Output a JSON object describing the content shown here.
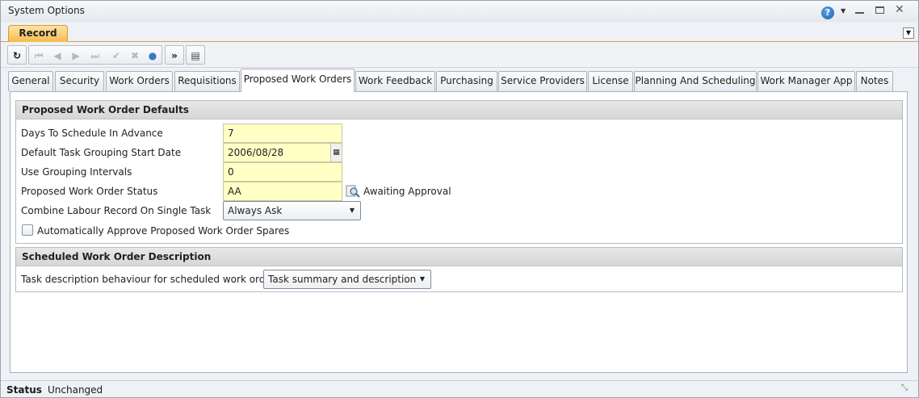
{
  "window": {
    "title": "System Options"
  },
  "ribbon": {
    "tab_label": "Record"
  },
  "toolbar": {
    "icons": [
      "refresh-icon",
      "first-record-icon",
      "previous-record-icon",
      "next-record-icon",
      "last-record-icon",
      "accept-icon",
      "cancel-icon",
      "users-icon",
      "more-icon",
      "list-icon"
    ]
  },
  "tabs": [
    {
      "label": "General"
    },
    {
      "label": "Security"
    },
    {
      "label": "Work Orders"
    },
    {
      "label": "Requisitions"
    },
    {
      "label": "Proposed Work Orders",
      "active": true
    },
    {
      "label": "Work Feedback"
    },
    {
      "label": "Purchasing"
    },
    {
      "label": "Service Providers"
    },
    {
      "label": "License"
    },
    {
      "label": "Planning And Scheduling"
    },
    {
      "label": "Work Manager App"
    },
    {
      "label": "Notes"
    }
  ],
  "proposed_defaults": {
    "title": "Proposed Work Order Defaults",
    "days_label": "Days To Schedule In Advance",
    "days_value": "7",
    "start_date_label": "Default Task Grouping Start Date",
    "start_date_value": "2006/08/28",
    "intervals_label": "Use Grouping Intervals",
    "intervals_value": "0",
    "status_label": "Proposed Work Order Status",
    "status_value": "AA",
    "status_description": "Awaiting Approval",
    "combine_label": "Combine Labour Record On Single Task",
    "combine_value": "Always Ask",
    "auto_approve_label": "Automatically Approve Proposed Work Order Spares",
    "auto_approve_checked": false
  },
  "scheduled_description": {
    "title": "Scheduled Work Order Description",
    "behaviour_label": "Task description behaviour for scheduled work orders",
    "behaviour_value": "Task summary and description"
  },
  "statusbar": {
    "label": "Status",
    "value": "Unchanged"
  },
  "colors": {
    "accent_tab": "#f7b84a",
    "input_background": "#ffffc6"
  }
}
